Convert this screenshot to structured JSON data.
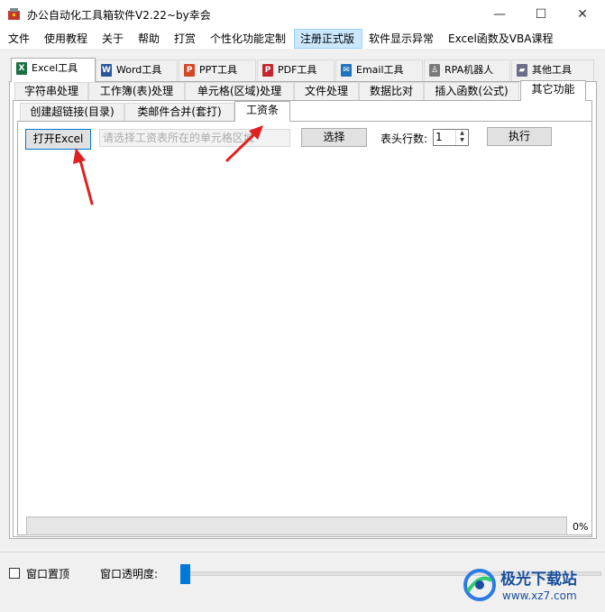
{
  "window": {
    "title": "办公自动化工具箱软件V2.22~by幸会",
    "controls": {
      "minimize": "—",
      "maximize": "☐",
      "close": "✕"
    }
  },
  "menubar": {
    "items": [
      "文件",
      "使用教程",
      "关于",
      "帮助",
      "打赏",
      "个性化功能定制",
      "注册正式版",
      "软件显示异常",
      "Excel函数及VBA课程"
    ],
    "active_index": 6
  },
  "app_tabs": [
    {
      "label": "Excel工具",
      "icon": "excel-icon",
      "icon_text": "X",
      "color": "#1d6f42"
    },
    {
      "label": "Word工具",
      "icon": "word-icon",
      "icon_text": "W",
      "color": "#2b579a"
    },
    {
      "label": "PPT工具",
      "icon": "ppt-icon",
      "icon_text": "P",
      "color": "#d24726"
    },
    {
      "label": "PDF工具",
      "icon": "pdf-icon",
      "icon_text": "P",
      "color": "#c4262e"
    },
    {
      "label": "Email工具",
      "icon": "email-icon",
      "icon_text": "✉",
      "color": "#1e73be"
    },
    {
      "label": "RPA机器人",
      "icon": "robot-icon",
      "icon_text": "♙",
      "color": "#7a7a7a"
    },
    {
      "label": "其他工具",
      "icon": "folder-icon",
      "icon_text": "▰",
      "color": "#6b6b8a"
    }
  ],
  "sub_tabs": [
    "字符串处理",
    "工作簿(表)处理",
    "单元格(区域)处理",
    "文件处理",
    "数据比对",
    "插入函数(公式)",
    "其它功能"
  ],
  "third_tabs": [
    "创建超链接(目录)",
    "类邮件合并(套打)",
    "工资条"
  ],
  "form": {
    "open_excel_label": "打开Excel",
    "cell_placeholder": "请选择工资表所在的单元格区域",
    "select_label": "选择",
    "header_rows_label": "表头行数:",
    "header_rows_value": "1",
    "execute_label": "执行"
  },
  "progress": {
    "value": 0,
    "text": "0%"
  },
  "bottom": {
    "topmost_label": "窗口置顶",
    "opacity_label": "窗口透明度:"
  },
  "watermark": {
    "title": "极光下载站",
    "url": "www.xz7.com"
  }
}
